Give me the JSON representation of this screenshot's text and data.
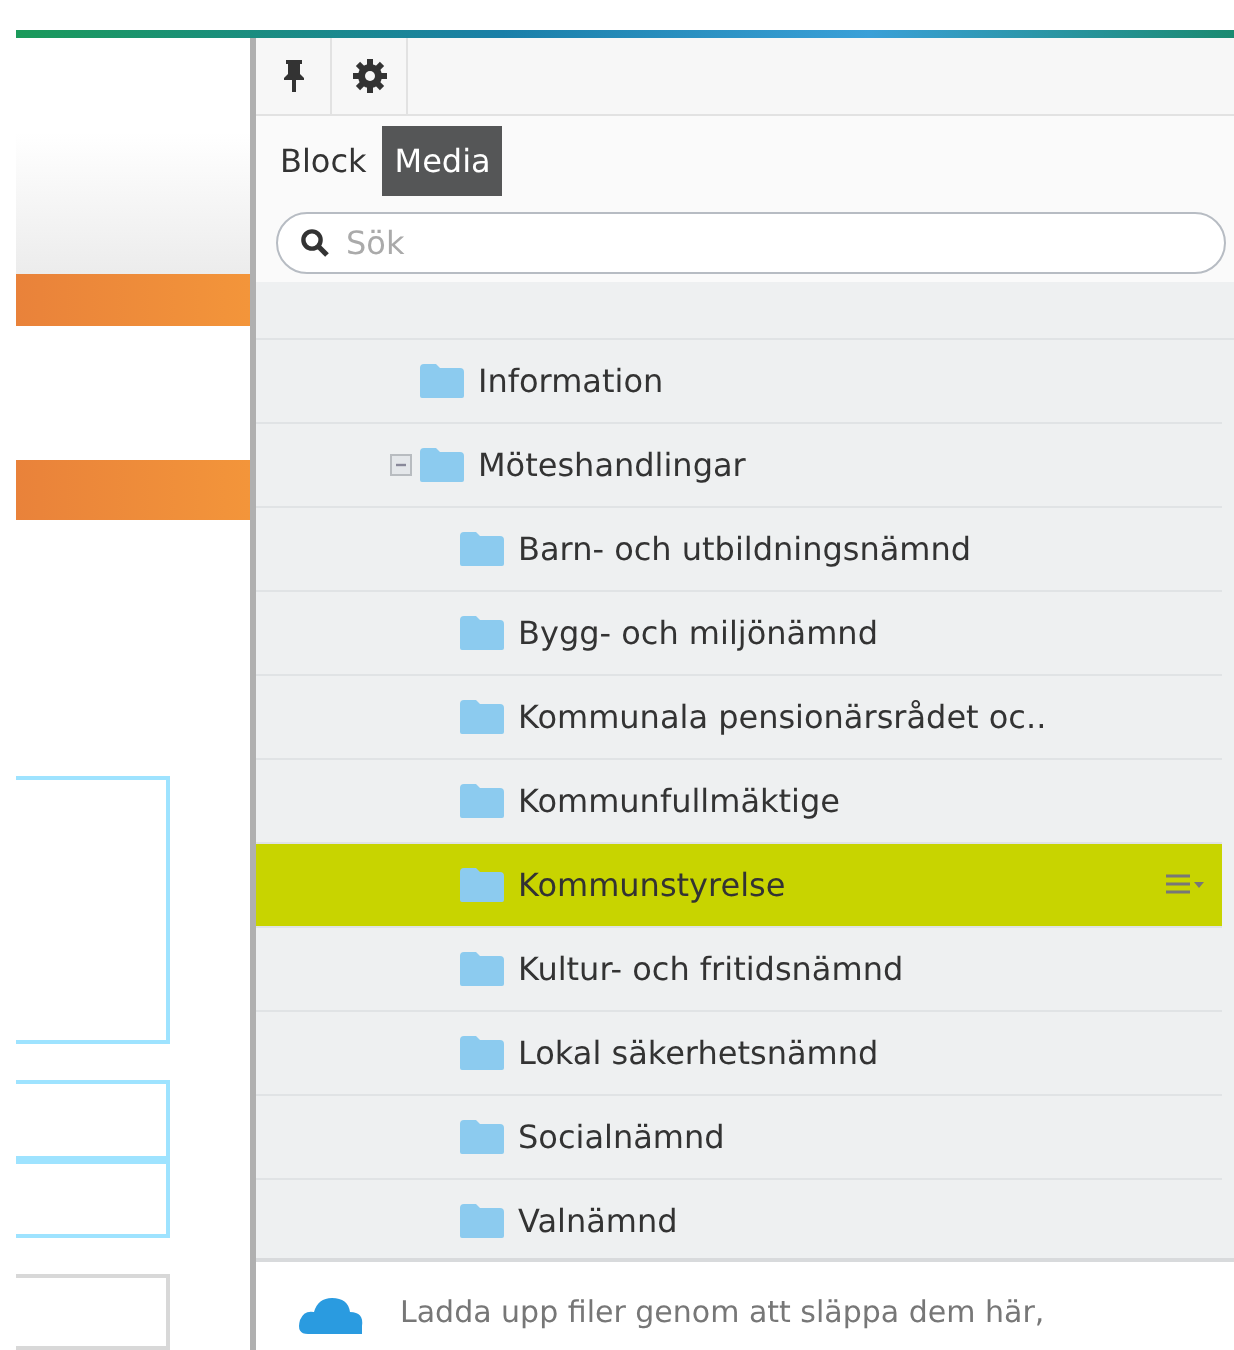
{
  "tabs": [
    {
      "label": "Block",
      "selected": false
    },
    {
      "label": "Media",
      "selected": true
    }
  ],
  "search": {
    "placeholder": "Sök"
  },
  "tree": [
    {
      "label": "Information",
      "selected": false
    },
    {
      "label": "Möteshandlingar",
      "selected": false,
      "expanded": true,
      "children": [
        {
          "label": "Barn- och utbildningsnämnd",
          "selected": false
        },
        {
          "label": "Bygg- och miljönämnd",
          "selected": false
        },
        {
          "label": "Kommunala pensionärsrådet oc..",
          "selected": false
        },
        {
          "label": "Kommunfullmäktige",
          "selected": false
        },
        {
          "label": "Kommunstyrelse",
          "selected": true
        },
        {
          "label": "Kultur- och fritidsnämnd",
          "selected": false
        },
        {
          "label": "Lokal säkerhetsnämnd",
          "selected": false
        },
        {
          "label": "Socialnämnd",
          "selected": false
        },
        {
          "label": "Valnämnd",
          "selected": false
        }
      ]
    }
  ],
  "upload": {
    "text": "Ladda upp filer genom att släppa dem här,"
  }
}
